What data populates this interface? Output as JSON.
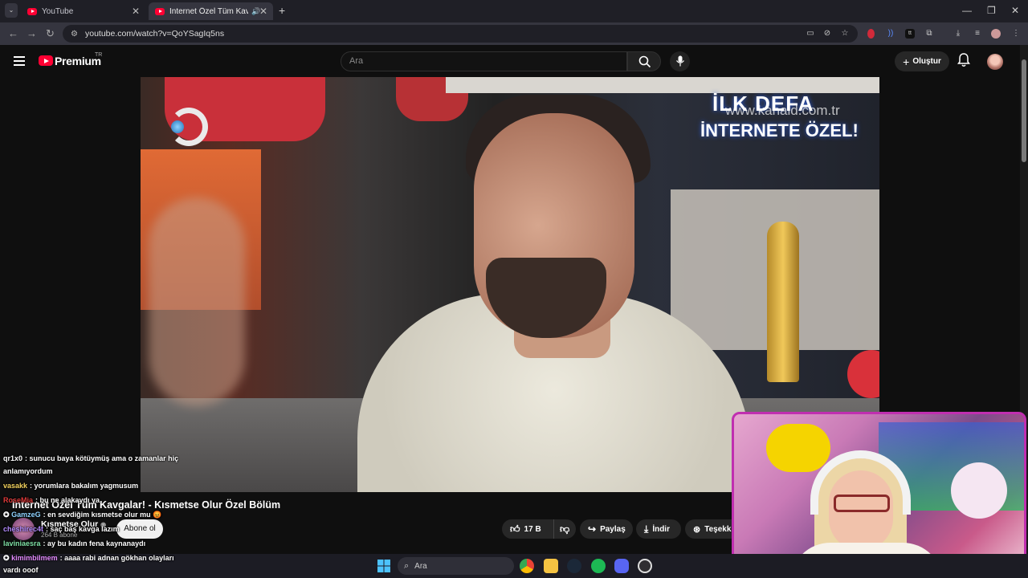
{
  "browser": {
    "tabs": [
      {
        "title": "YouTube",
        "active": false
      },
      {
        "title": "İnternet Özel Tüm Kavgalar!",
        "active": true
      }
    ],
    "url": "youtube.com/watch?v=QoYSagIq5ns"
  },
  "youtube": {
    "brand": "Premium",
    "region": "TR",
    "search_placeholder": "Ara",
    "create_label": "Oluştur"
  },
  "video": {
    "banner_line1": "İLK DEFA",
    "banner_line2": "İNTERNETE ÖZEL!",
    "watermark": "www.kanald.com.tr",
    "title": "İnternet Özel Tüm Kavgalar! - Kısmetse Olur Özel Bölüm",
    "channel": "Kısmetse Olur",
    "verified_icon": "verified-icon",
    "subscribers": "264 B abone",
    "subscribe_label": "Abone ol",
    "likes": "17 B",
    "share_label": "Paylaş",
    "download_label": "İndir",
    "thanks_label": "Teşekk"
  },
  "chat": [
    {
      "user": "qr1x0",
      "color": "#ffffff",
      "message": "sunucu baya kötüymüş ama o zamanlar hiç",
      "cont": "anlamıyordum"
    },
    {
      "user": "vasakk",
      "color": "#f4d35e",
      "message": "yorumlara bakalım yagmusum"
    },
    {
      "user": "RoseMia",
      "color": "#e03a3a",
      "message": "bu ne alakaydı ya"
    },
    {
      "user": "GamzeG",
      "color": "#8fd3ff",
      "message": "en sevdiğim kısmetse olur mu 😡"
    },
    {
      "user": "cheshirec4t",
      "color": "#b58cff",
      "message": "saç baş kavga lazım"
    },
    {
      "user": "laviniaesra",
      "color": "#7fe0a5",
      "message": "ay bu kadın fena kaynanaydı"
    },
    {
      "user": "kimimbilmem",
      "color": "#e48cff",
      "message": "aaaa rabi adnan gökhan olayları",
      "cont": "vardı ooof"
    }
  ],
  "taskbar": {
    "search_placeholder": "Ara"
  }
}
